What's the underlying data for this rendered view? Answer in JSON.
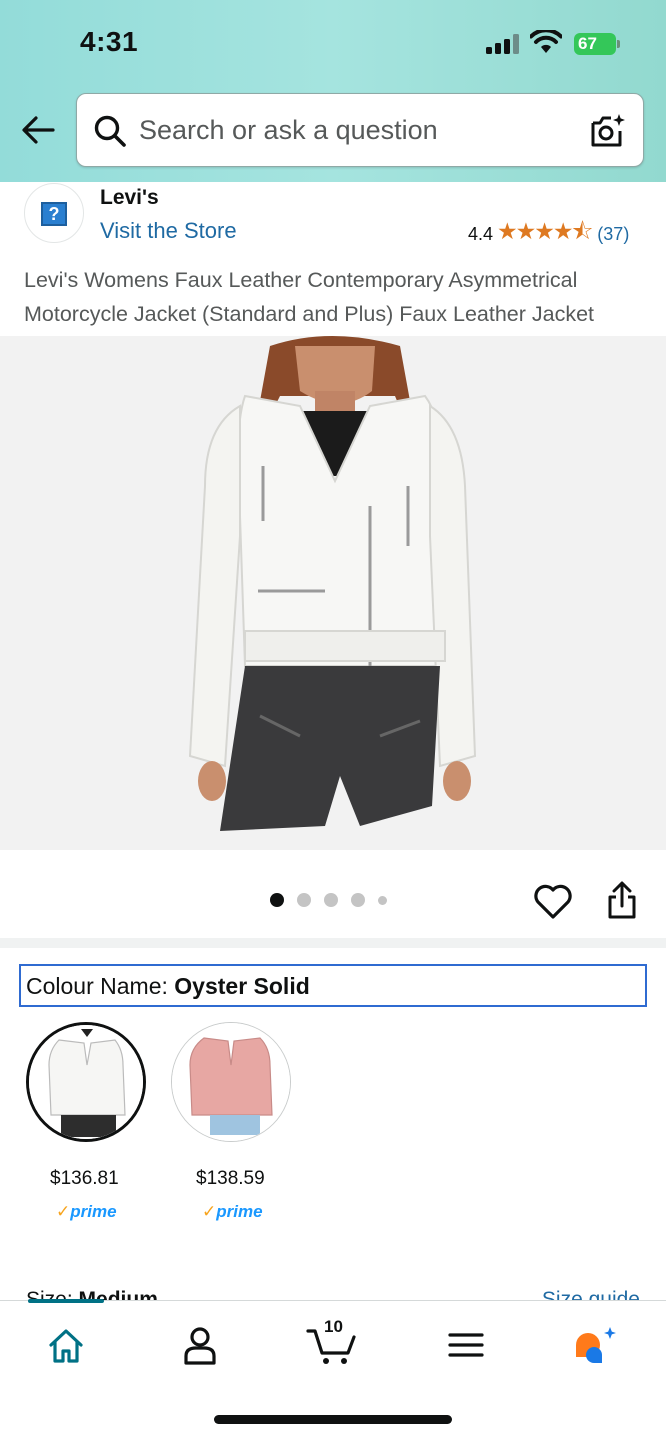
{
  "status_bar": {
    "time": "4:31",
    "battery": "67"
  },
  "header": {
    "search_placeholder": "Search or ask a question"
  },
  "brand": {
    "name": "Levi's",
    "visit_store": "Visit the Store",
    "rating": "4.4",
    "stars": "★★★★⯪",
    "review_count": "(37)"
  },
  "product": {
    "title": "Levi's Womens Faux Leather Contemporary Asymmetrical Motorcycle Jacket (Standard and Plus) Faux Leather Jacket",
    "image_count": 5,
    "active_image": 1
  },
  "colour": {
    "label": "Colour Name: ",
    "value": "Oyster Solid",
    "options": [
      {
        "name": "Oyster Solid",
        "price": "$136.81",
        "prime": "prime"
      },
      {
        "name": "Pink",
        "price": "$138.59",
        "prime": "prime"
      }
    ]
  },
  "size": {
    "label": "Size: ",
    "value": "Medium",
    "guide": "Size guide"
  },
  "bottom_nav": {
    "cart_count": "10",
    "items": [
      "home",
      "account",
      "cart",
      "menu",
      "rufus"
    ]
  },
  "colors": {
    "accent": "#007185",
    "link": "#1f6aa3",
    "star": "#de7921",
    "prime": "#1a98ff",
    "selection_border": "#2f6bd1"
  }
}
